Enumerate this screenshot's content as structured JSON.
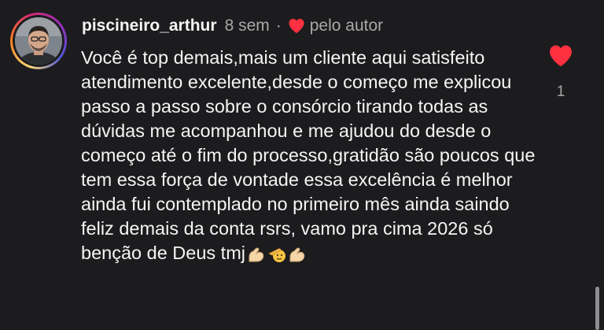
{
  "comment": {
    "username": "piscineiro_arthur",
    "time_ago": "8 sem",
    "separator": "·",
    "liked_by_author_label": "pelo autor",
    "text": "Você é top demais,mais um cliente aqui satisfeito atendimento excelente,desde o começo me explicou passo a passo sobre o consórcio tirando todas as dúvidas me acompanhou e me ajudou do desde o começo até o fim do processo,gratidão são poucos que tem essa força de vontade essa excelência é melhor ainda fui contemplado no primeiro mês ainda saindo feliz demais da conta rsrs, vamo pra cima 2026 só benção de Deus tmj",
    "trailing_emojis": [
      "flexed-biceps-emoji",
      "saluting-face-emoji",
      "flexed-biceps-emoji"
    ],
    "like_count": "1",
    "like_state": "liked"
  },
  "colors": {
    "background": "#1c1c1e",
    "text": "#f5f5f5",
    "muted": "#a8a8a8",
    "heart": "#ff3040"
  },
  "icons": {
    "like": "heart-filled-icon",
    "author_like": "heart-filled-icon"
  }
}
